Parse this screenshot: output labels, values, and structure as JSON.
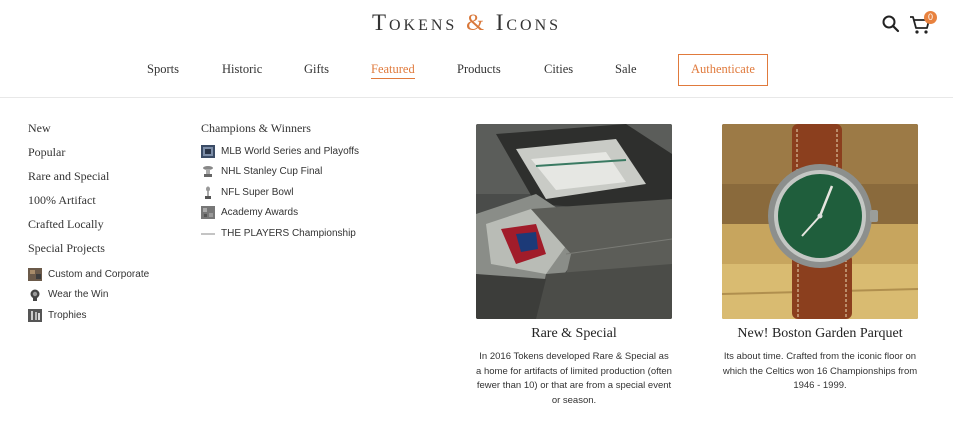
{
  "header": {
    "logo_part1": "Tokens",
    "logo_amp": "&",
    "logo_part2": "Icons",
    "cart_count": "0"
  },
  "nav": {
    "items": [
      {
        "label": "Sports"
      },
      {
        "label": "Historic"
      },
      {
        "label": "Gifts"
      },
      {
        "label": "Featured"
      },
      {
        "label": "Products"
      },
      {
        "label": "Cities"
      },
      {
        "label": "Sale"
      },
      {
        "label": "Authenticate"
      }
    ]
  },
  "menu": {
    "col1": {
      "links": [
        "New",
        "Popular",
        "Rare and Special",
        "100% Artifact",
        "Crafted Locally",
        "Special Projects"
      ],
      "sublinks": [
        "Custom and Corporate",
        "Wear the Win",
        "Trophies"
      ]
    },
    "col2": {
      "heading": "Champions & Winners",
      "sublinks": [
        "MLB World Series and Playoffs",
        "NHL Stanley Cup Final",
        "NFL Super Bowl",
        "Academy Awards",
        "THE PLAYERS Championship"
      ]
    }
  },
  "cards": [
    {
      "title": "Rare & Special",
      "desc": "In 2016 Tokens developed Rare & Special as a home for artifacts of limited production (often fewer than 10) or that are from a special event or season."
    },
    {
      "title": "New! Boston Garden Parquet",
      "desc": "Its about time. Crafted from the iconic floor on which the Celtics won 16 Championships from 1946 - 1999."
    }
  ],
  "colors": {
    "accent": "#e07a3c",
    "badge": "#e8823f",
    "text": "#333333"
  },
  "icons": {
    "search": "search-icon",
    "cart": "cart-icon"
  }
}
